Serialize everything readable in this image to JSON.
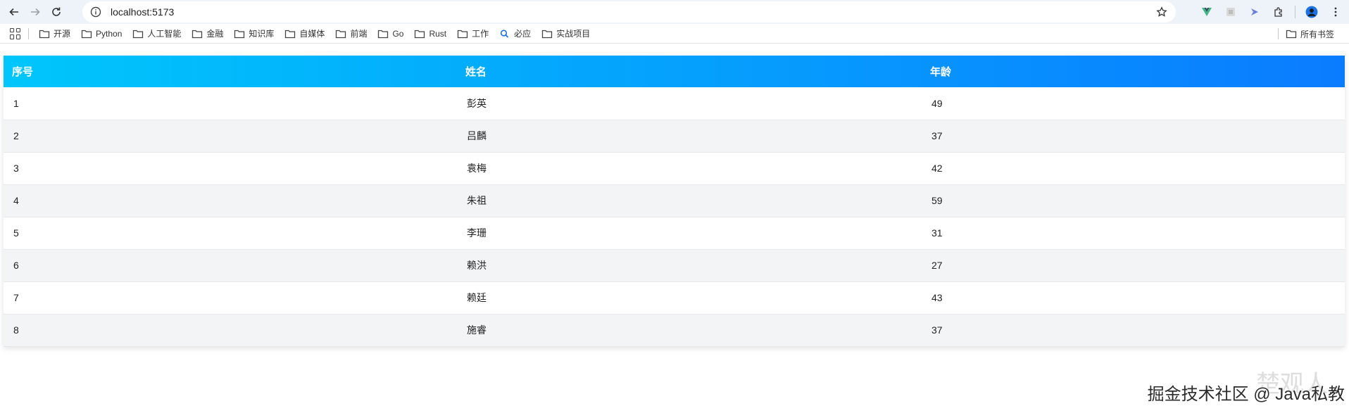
{
  "browser": {
    "url": "localhost:5173",
    "bookmarks": [
      {
        "label": "开源",
        "icon": "folder-icon"
      },
      {
        "label": "Python",
        "icon": "folder-icon"
      },
      {
        "label": "人工智能",
        "icon": "folder-icon"
      },
      {
        "label": "金融",
        "icon": "folder-icon"
      },
      {
        "label": "知识库",
        "icon": "folder-icon"
      },
      {
        "label": "自媒体",
        "icon": "folder-icon"
      },
      {
        "label": "前端",
        "icon": "folder-icon"
      },
      {
        "label": "Go",
        "icon": "folder-icon"
      },
      {
        "label": "Rust",
        "icon": "folder-icon"
      },
      {
        "label": "工作",
        "icon": "folder-icon"
      },
      {
        "label": "必应",
        "icon": "search-icon"
      },
      {
        "label": "实战项目",
        "icon": "folder-icon"
      }
    ],
    "all_bookmarks_label": "所有书签"
  },
  "table": {
    "headers": [
      "序号",
      "姓名",
      "年龄"
    ],
    "rows": [
      [
        "1",
        "彭英",
        "49"
      ],
      [
        "2",
        "吕麟",
        "37"
      ],
      [
        "3",
        "袁梅",
        "42"
      ],
      [
        "4",
        "朱祖",
        "59"
      ],
      [
        "5",
        "李珊",
        "31"
      ],
      [
        "6",
        "赖洪",
        "27"
      ],
      [
        "7",
        "赖廷",
        "43"
      ],
      [
        "8",
        "施睿",
        "37"
      ]
    ]
  },
  "watermark": {
    "text": "掘金技术社区 @ Java私教",
    "ghost": "楚观人"
  },
  "colors": {
    "header_gradient_start": "#00c6fb",
    "header_gradient_end": "#0a7cff",
    "row_alt": "#f3f4f6"
  }
}
